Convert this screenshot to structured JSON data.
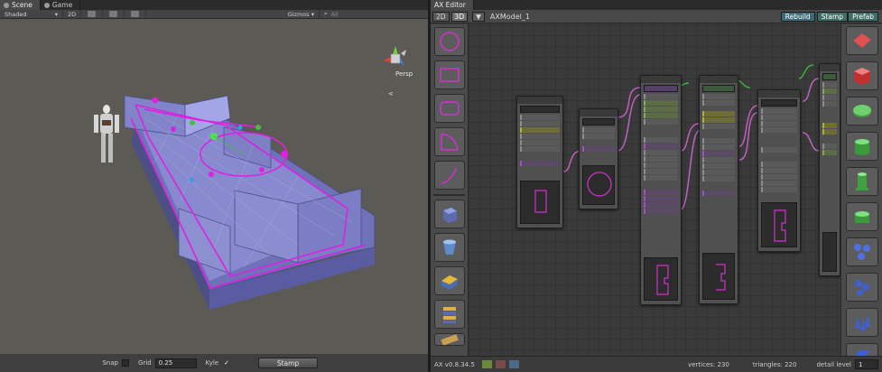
{
  "scene_window": {
    "tabs": [
      {
        "label": "Scene",
        "active": true
      },
      {
        "label": "Game",
        "active": false
      }
    ],
    "toolbar": {
      "shading_mode": "Shaded",
      "mode_2d": "2D",
      "gizmos_label": "Gizmos",
      "search_placeholder": "All"
    },
    "projection_label": "Persp",
    "status": {
      "snap_label": "Snap",
      "grid_label": "Grid",
      "grid_value": "0.25",
      "kyle_label": "Kyle",
      "kyle_checked": true,
      "stamp_label": "Stamp"
    }
  },
  "ax_editor": {
    "tab_label": "AX Editor",
    "mode_buttons": [
      "2D",
      "3D"
    ],
    "model_name": "AXModel_1",
    "actions": {
      "rebuild": "Rebuild",
      "stamp": "Stamp",
      "prefab": "Prefab"
    },
    "status": {
      "version": "AX v0.8.34.5",
      "vertices_label": "vertices: 230",
      "triangles_label": "triangles: 220",
      "detail_label": "detail level",
      "detail_value": "1"
    }
  },
  "shape_tools": [
    "circle-shape-icon",
    "rectangle-shape-icon",
    "rounded-rect-shape-icon",
    "corner-arc-shape-icon",
    "curve-shape-icon"
  ],
  "mesh_tools": [
    "cube-mesh-icon",
    "cylinder-mesh-icon",
    "platform-mesh-icon",
    "stairs-mesh-icon",
    "ruler-mesh-icon"
  ],
  "primitive_tools": [
    "plane-prim-icon",
    "cube-prim-icon",
    "disc-prim-icon",
    "cylinder-prim-icon",
    "column-prim-icon",
    "pillar-prim-icon",
    "scatter-prim-icon",
    "repeater-prim-icon",
    "spikes-prim-icon",
    "stair-prim-icon"
  ],
  "colors": {
    "accent_magenta": "#d030d0",
    "wire_purple": "#c060c0",
    "teal_button": "#3f6e6a",
    "node_green": "#4ec04e",
    "selection_yellow": "#c8c040"
  }
}
